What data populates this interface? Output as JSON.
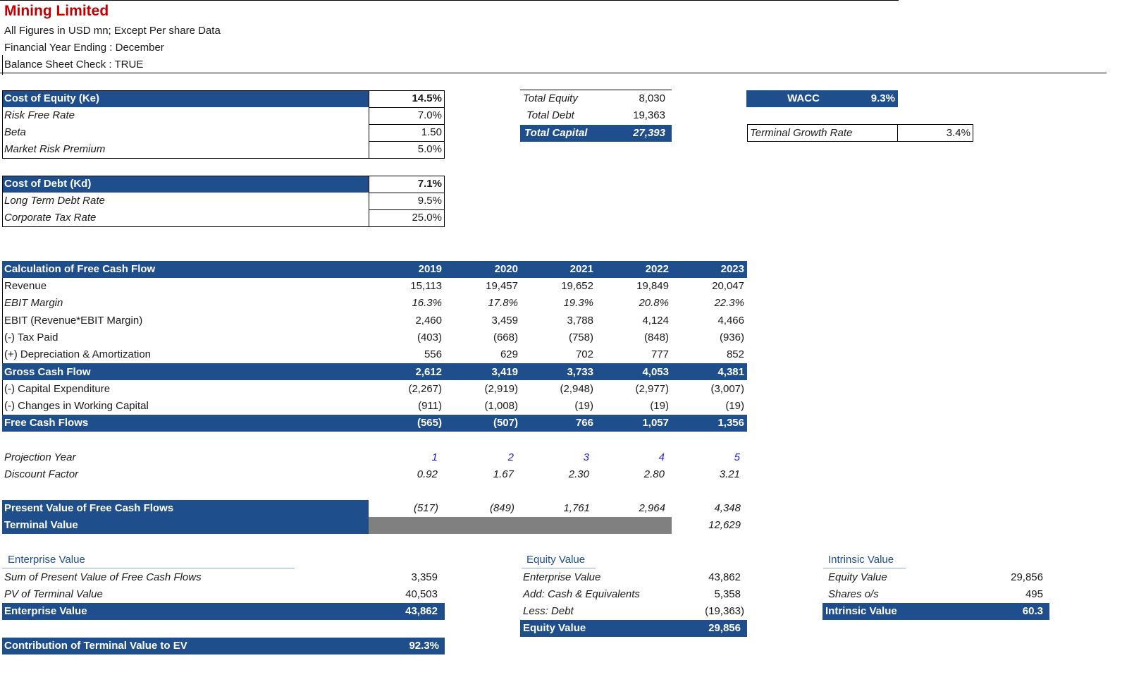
{
  "header": {
    "title": "Mining Limited",
    "line1": "All Figures in USD mn; Except Per share Data",
    "line2": "Financial Year Ending : December",
    "line3": "Balance Sheet Check : TRUE"
  },
  "cost_of_equity": {
    "label": "Cost of Equity (Ke)",
    "value": "14.5%",
    "rows": [
      {
        "label": "Risk Free Rate",
        "value": "7.0%"
      },
      {
        "label": "Beta",
        "value": "1.50"
      },
      {
        "label": "Market Risk Premium",
        "value": "5.0%"
      }
    ]
  },
  "cost_of_debt": {
    "label": "Cost of Debt (Kd)",
    "value": "7.1%",
    "rows": [
      {
        "label": "Long Term Debt Rate",
        "value": "9.5%"
      },
      {
        "label": "Corporate Tax Rate",
        "value": "25.0%"
      }
    ]
  },
  "capital": {
    "total_equity_label": "Total Equity",
    "total_equity": "8,030",
    "total_debt_label": "Total Debt",
    "total_debt": "19,363",
    "total_capital_label": "Total Capital",
    "total_capital": "27,393"
  },
  "wacc": {
    "label": "WACC",
    "value": "9.3%"
  },
  "terminal_growth": {
    "label": "Terminal Growth Rate",
    "value": "3.4%"
  },
  "fcf": {
    "title": "Calculation of Free Cash Flow",
    "years": [
      "2019",
      "2020",
      "2021",
      "2022",
      "2023"
    ],
    "rows": [
      {
        "label": "Revenue",
        "values": [
          "15,113",
          "19,457",
          "19,652",
          "19,849",
          "20,047"
        ]
      },
      {
        "label": "EBIT Margin",
        "values": [
          "16.3%",
          "17.8%",
          "19.3%",
          "20.8%",
          "22.3%"
        ]
      },
      {
        "label": "EBIT (Revenue*EBIT Margin)",
        "values": [
          "2,460",
          "3,459",
          "3,788",
          "4,124",
          "4,466"
        ]
      },
      {
        "label": "(-) Tax Paid",
        "values": [
          "(403)",
          "(668)",
          "(758)",
          "(848)",
          "(936)"
        ]
      },
      {
        "label": "(+) Depreciation & Amortization",
        "values": [
          "556",
          "629",
          "702",
          "777",
          "852"
        ]
      },
      {
        "label": "Gross Cash Flow",
        "values": [
          "2,612",
          "3,419",
          "3,733",
          "4,053",
          "4,381"
        ]
      },
      {
        "label": "(-) Capital Expenditure",
        "values": [
          "(2,267)",
          "(2,919)",
          "(2,948)",
          "(2,977)",
          "(3,007)"
        ]
      },
      {
        "label": "(-) Changes in Working Capital",
        "values": [
          "(911)",
          "(1,008)",
          "(19)",
          "(19)",
          "(19)"
        ]
      },
      {
        "label": "Free Cash Flows",
        "values": [
          "(565)",
          "(507)",
          "766",
          "1,057",
          "1,356"
        ]
      }
    ]
  },
  "projection": {
    "year_label": "Projection Year",
    "years": [
      "1",
      "2",
      "3",
      "4",
      "5"
    ],
    "discount_label": "Discount Factor",
    "factors": [
      "0.92",
      "1.67",
      "2.30",
      "2.80",
      "3.21"
    ]
  },
  "pv": {
    "label": "Present Value of Free Cash Flows",
    "values": [
      "(517)",
      "(849)",
      "1,761",
      "2,964",
      "4,348"
    ],
    "terminal_label": "Terminal Value",
    "terminal_value": "12,629"
  },
  "enterprise_value": {
    "heading": "Enterprise Value",
    "rows": [
      {
        "label": "Sum of Present Value of Free Cash Flows",
        "value": "3,359"
      },
      {
        "label": "PV of Terminal Value",
        "value": "40,503"
      }
    ],
    "total_label": "Enterprise Value",
    "total": "43,862"
  },
  "equity_value": {
    "heading": "Equity Value",
    "rows": [
      {
        "label": "Enterprise Value",
        "value": "43,862"
      },
      {
        "label": "Add: Cash & Equivalents",
        "value": "5,358"
      },
      {
        "label": "Less: Debt",
        "value": "(19,363)"
      }
    ],
    "total_label": "Equity Value",
    "total": "29,856"
  },
  "intrinsic_value": {
    "heading": "Intrinsic Value",
    "rows": [
      {
        "label": "Equity Value",
        "value": "29,856"
      },
      {
        "label": "Shares o/s",
        "value": "495"
      }
    ],
    "total_label": "Intrinsic Value",
    "total": "60.3"
  },
  "contribution": {
    "label": "Contribution of Terminal Value to EV",
    "value": "92.3%"
  },
  "colors": {
    "header_blue": "#1f4e8c",
    "title_red": "#c00000",
    "blank_grey": "#808080",
    "projection_blue": "#1f1fd1"
  }
}
